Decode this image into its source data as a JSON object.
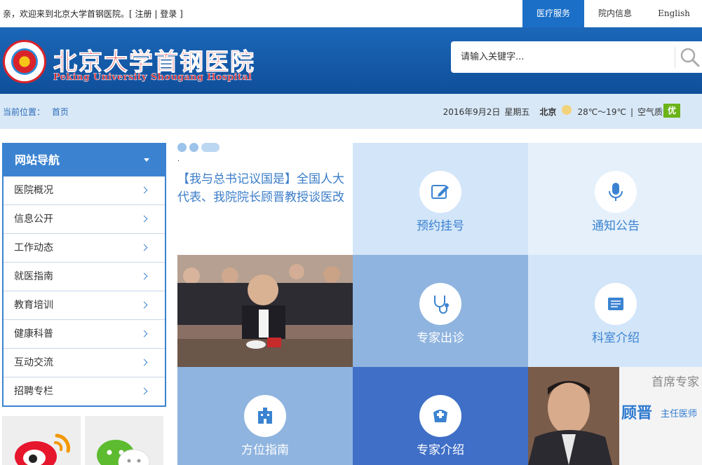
{
  "topbar": {
    "welcome": "亲，欢迎来到北京大学首钢医院。[",
    "register": "注册",
    "separator": "|",
    "login": "登录",
    "close_bracket": "]",
    "tabs": [
      {
        "label": "医疗服务",
        "active": true
      },
      {
        "label": "院内信息",
        "active": false
      },
      {
        "label": "English",
        "active": false
      }
    ]
  },
  "header": {
    "logo_cn": "北京大学首钢医院",
    "logo_en": "Peking University Shougang Hospital",
    "search_placeholder": "请输入关键字..."
  },
  "infobar": {
    "location_label": "当前位置：",
    "location_home": "首页",
    "date": "2016年9月2日",
    "weekday": "星期五",
    "city": "北京",
    "temperature": "28℃～19℃",
    "divider": "|",
    "air_label": "空气质量：",
    "air_value": "优"
  },
  "nav": {
    "title": "网站导航",
    "items": [
      {
        "label": "医院概况"
      },
      {
        "label": "信息公开"
      },
      {
        "label": "工作动态"
      },
      {
        "label": "就医指南"
      },
      {
        "label": "教育培训"
      },
      {
        "label": "健康科普"
      },
      {
        "label": "互动交流"
      },
      {
        "label": "招聘专栏"
      }
    ]
  },
  "news": {
    "title": "【我与总书记议国是】全国人大代表、我院院长顾晋教授谈医改",
    "dot_text": "."
  },
  "tiles": [
    {
      "label": "预约挂号",
      "icon": "pen-edit-icon"
    },
    {
      "label": "通知公告",
      "icon": "microphone-icon"
    },
    {
      "label": "专家出诊",
      "icon": "stethoscope-icon"
    },
    {
      "label": "科室介绍",
      "icon": "document-icon"
    },
    {
      "label": "方位指南",
      "icon": "building-icon"
    },
    {
      "label": "专家介绍",
      "icon": "nurse-cap-icon"
    }
  ],
  "expert": {
    "title": "首席专家",
    "name": "顾晋",
    "role": "主任医师"
  },
  "colors": {
    "brand_blue": "#1b6fc7",
    "header_blue": "#1c67b8",
    "nav_blue": "#3b83d1",
    "logo_red": "#d9232a",
    "air_good": "#6cb31a"
  }
}
